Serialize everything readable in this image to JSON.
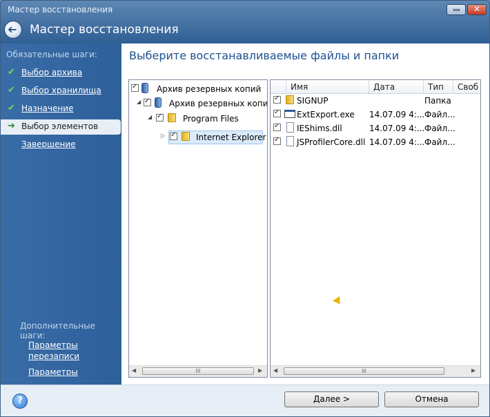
{
  "window": {
    "title": "Мастер восстановления",
    "close_glyph": "✕",
    "header_title": "Мастер восстановления",
    "back_glyph": "➔"
  },
  "sidebar": {
    "required_heading": "Обязательные шаги:",
    "steps": [
      {
        "label": "Выбор архива",
        "status": "done",
        "icon": "✔"
      },
      {
        "label": "Выбор хранилища",
        "status": "done",
        "icon": "✔"
      },
      {
        "label": "Назначение",
        "status": "done",
        "icon": "✔"
      },
      {
        "label": "Выбор элементов",
        "status": "current",
        "icon": "➔"
      },
      {
        "label": "Завершение",
        "status": "pending",
        "icon": ""
      }
    ],
    "optional_heading": "Дополнительные шаги:",
    "optional_links": [
      "Параметры перезаписи",
      "Параметры"
    ]
  },
  "content": {
    "title": "Выберите восстанавливаемые файлы и папки"
  },
  "tree": {
    "items": [
      {
        "label": "Архив резервных копий",
        "icon": "disk-icon",
        "checked": true
      },
      {
        "label": "Архив резервных копий",
        "icon": "disk-icon",
        "checked": true
      },
      {
        "label": "Program Files",
        "icon": "folder-icon",
        "checked": true
      },
      {
        "label": "Internet Explorer",
        "icon": "folder-icon",
        "checked": true,
        "selected": true
      }
    ]
  },
  "file_list": {
    "columns": [
      "Имя",
      "Дата",
      "Тип",
      "Своб"
    ],
    "rows": [
      {
        "name": "SIGNUP",
        "date": "",
        "type": "Папка",
        "icon": "folder-icon"
      },
      {
        "name": "ExtExport.exe",
        "date": "14.07.09 4:...",
        "type": "Файл...",
        "icon": "exe-icon"
      },
      {
        "name": "IEShims.dll",
        "date": "14.07.09 4:...",
        "type": "Файл...",
        "icon": "file-icon"
      },
      {
        "name": "JSProfilerCore.dll",
        "date": "14.07.09 4:...",
        "type": "Файл...",
        "icon": "file-icon"
      }
    ]
  },
  "scrollbar": {
    "thumb_grip": "III",
    "left_arrow": "◀",
    "right_arrow": "▶"
  },
  "buttons": {
    "help": "?",
    "next": "Далее >",
    "cancel": "Отмена"
  },
  "glyphs": {
    "check": "✓",
    "expanded": "◢",
    "collapsed": "▷"
  }
}
